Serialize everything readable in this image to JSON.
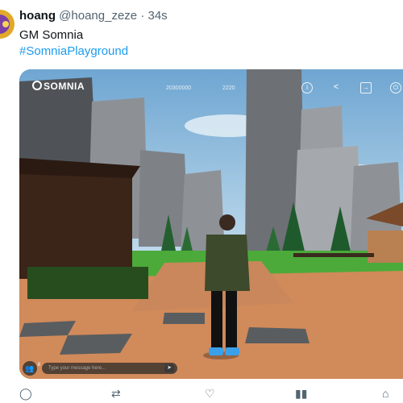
{
  "tweet": {
    "display_name": "hoang",
    "handle": "@hoang_zeze",
    "separator": "·",
    "time": "34s",
    "text": "GM Somnia",
    "hashtag": "#SomniaPlayground"
  },
  "game_ui": {
    "logo_text": "SOMNIA",
    "stat_1": "20300000",
    "stat_2": "2220",
    "chat_placeholder": "Type your message here...",
    "players_count": "8"
  },
  "icons": {
    "info": "info-icon",
    "share": "share-icon",
    "exit": "exit-icon",
    "power": "power-icon",
    "reply": "reply-icon",
    "retweet": "retweet-icon",
    "like": "like-icon",
    "views": "views-icon",
    "bookmark": "bookmark-icon"
  },
  "colors": {
    "hashtag": "#1d9bf0",
    "text": "#0f1419",
    "muted": "#536471"
  }
}
